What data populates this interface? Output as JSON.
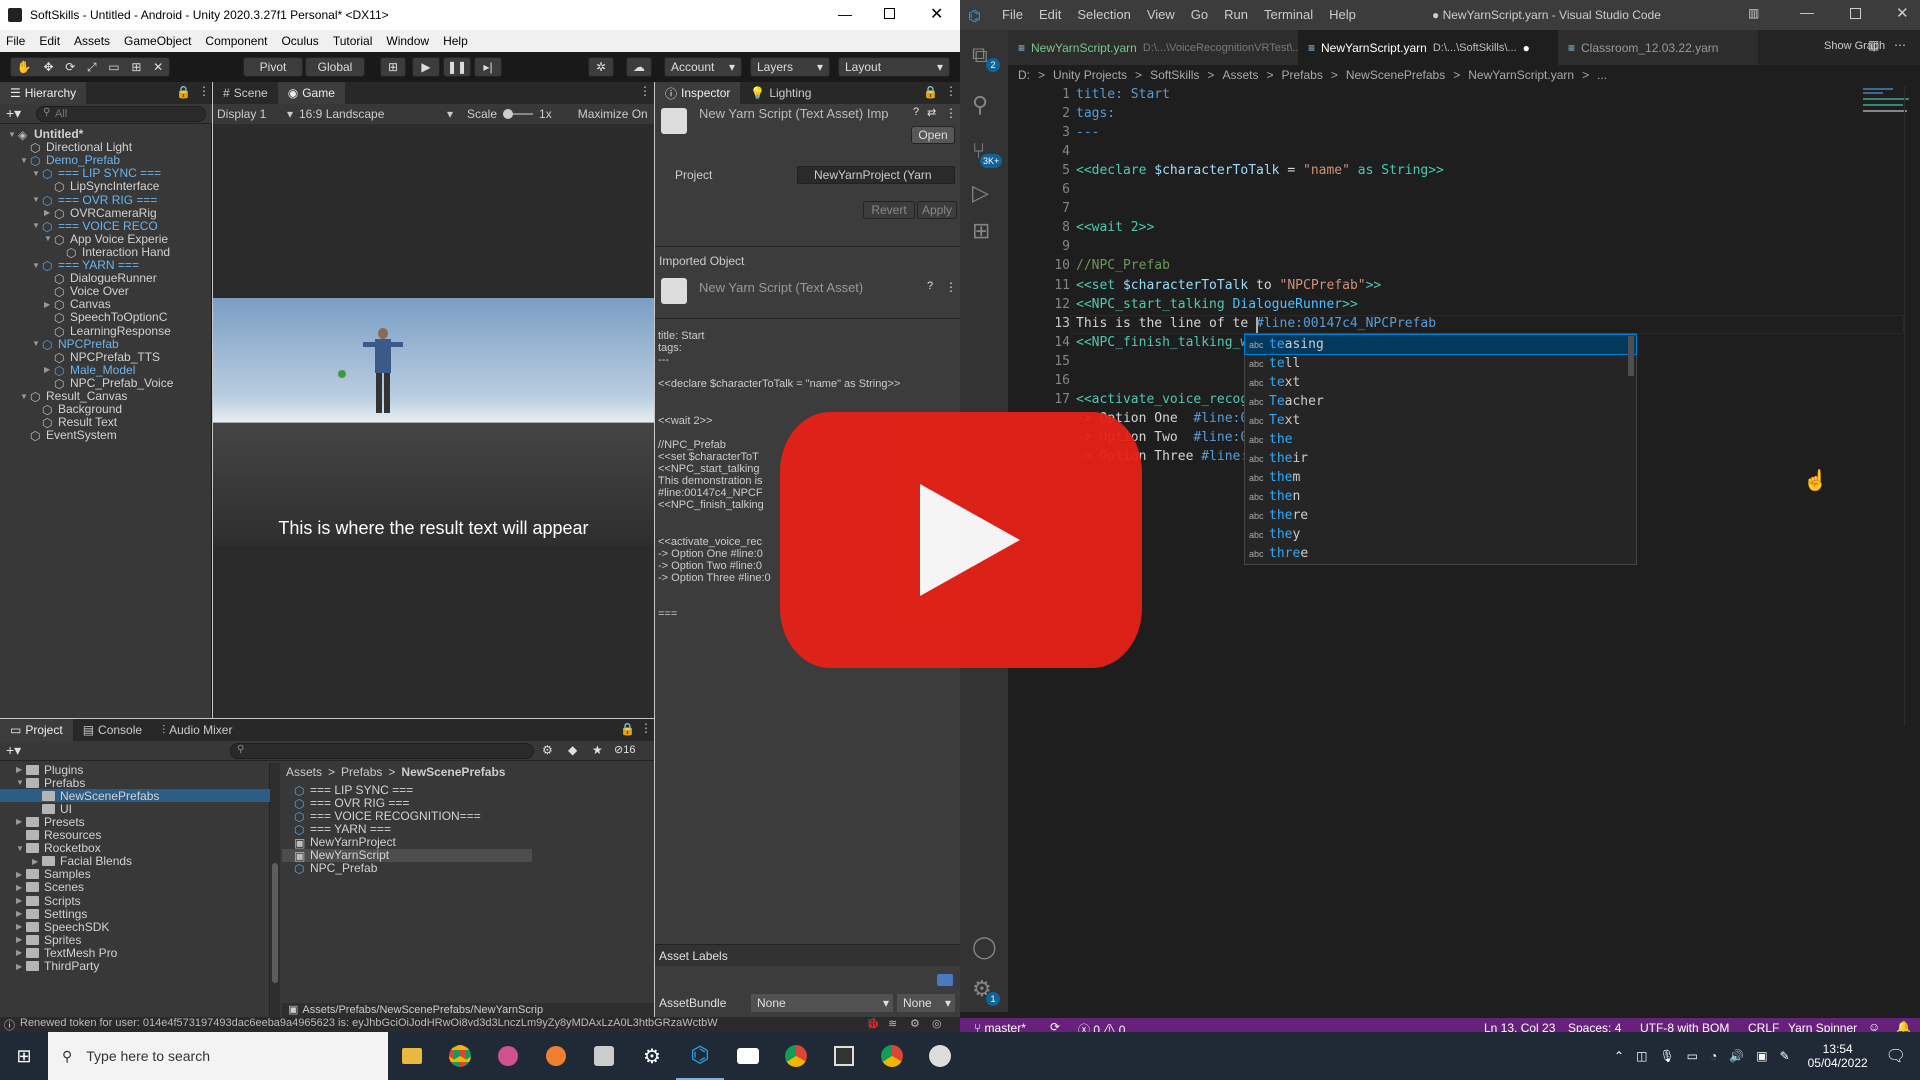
{
  "unity": {
    "title": "SoftSkills - Untitled - Android - Unity 2020.3.27f1 Personal* <DX11>",
    "menu": [
      "File",
      "Edit",
      "Assets",
      "GameObject",
      "Component",
      "Oculus",
      "Tutorial",
      "Window",
      "Help"
    ],
    "toolbar": {
      "pivot": "Pivot",
      "global": "Global",
      "account": "Account",
      "layers": "Layers",
      "layout": "Layout"
    },
    "hierarchy": {
      "tab": "Hierarchy",
      "search_placeholder": "All",
      "items": [
        {
          "label": "Untitled*",
          "depth": 0,
          "type": "scene",
          "fold": "open"
        },
        {
          "label": "Directional Light",
          "depth": 1,
          "type": "grey",
          "fold": ""
        },
        {
          "label": "Demo_Prefab",
          "depth": 1,
          "type": "blue",
          "fold": "open"
        },
        {
          "label": "=== LIP SYNC ===",
          "depth": 2,
          "type": "blue",
          "fold": "open"
        },
        {
          "label": "LipSyncInterface",
          "depth": 3,
          "type": "grey",
          "fold": ""
        },
        {
          "label": "=== OVR RIG ===",
          "depth": 2,
          "type": "blue",
          "fold": "open"
        },
        {
          "label": "OVRCameraRig",
          "depth": 3,
          "type": "grey",
          "fold": "closed"
        },
        {
          "label": "=== VOICE RECO",
          "depth": 2,
          "type": "blue",
          "fold": "open"
        },
        {
          "label": "App Voice Experie",
          "depth": 3,
          "type": "grey",
          "fold": "open"
        },
        {
          "label": "Interaction Hand",
          "depth": 4,
          "type": "grey",
          "fold": ""
        },
        {
          "label": "=== YARN ===",
          "depth": 2,
          "type": "blue",
          "fold": "open"
        },
        {
          "label": "DialogueRunner",
          "depth": 3,
          "type": "grey",
          "fold": ""
        },
        {
          "label": "Voice Over",
          "depth": 3,
          "type": "grey",
          "fold": ""
        },
        {
          "label": "Canvas",
          "depth": 3,
          "type": "grey",
          "fold": "closed"
        },
        {
          "label": "SpeechToOptionC",
          "depth": 3,
          "type": "grey",
          "fold": ""
        },
        {
          "label": "LearningResponse",
          "depth": 3,
          "type": "grey",
          "fold": ""
        },
        {
          "label": "NPCPrefab",
          "depth": 2,
          "type": "blue",
          "fold": "open"
        },
        {
          "label": "NPCPrefab_TTS",
          "depth": 3,
          "type": "grey",
          "fold": ""
        },
        {
          "label": "Male_Model",
          "depth": 3,
          "type": "blue",
          "fold": "closed"
        },
        {
          "label": "NPC_Prefab_Voice",
          "depth": 3,
          "type": "grey",
          "fold": ""
        },
        {
          "label": "Result_Canvas",
          "depth": 1,
          "type": "grey",
          "fold": "open"
        },
        {
          "label": "Background",
          "depth": 2,
          "type": "grey",
          "fold": ""
        },
        {
          "label": "Result Text",
          "depth": 2,
          "type": "grey",
          "fold": ""
        },
        {
          "label": "EventSystem",
          "depth": 1,
          "type": "grey",
          "fold": ""
        }
      ]
    },
    "game": {
      "tab_scene": "Scene",
      "tab_game": "Game",
      "display": "Display 1",
      "aspect": "16:9 Landscape",
      "scale_label": "Scale",
      "scale_value": "1x",
      "maximize": "Maximize On",
      "result_text": "This is where the result text will appear"
    },
    "inspector": {
      "tab": "Inspector",
      "tab2": "Lighting",
      "asset_title": "New Yarn Script (Text Asset) Imp",
      "open_btn": "Open",
      "project_label": "Project",
      "project_value": "NewYarnProject (Yarn",
      "revert": "Revert",
      "apply": "Apply",
      "imported_header": "Imported Object",
      "imported_title": "New Yarn Script (Text Asset)",
      "preview_lines": [
        "title: Start",
        "tags:",
        "---",
        "",
        "<<declare $characterToTalk = \"name\" as String>>",
        "",
        "",
        "<<wait 2>>",
        "",
        "//NPC_Prefab",
        "<<set $characterToT",
        "<<NPC_start_talking",
        "This demonstration is",
        "#line:00147c4_NPCF",
        "<<NPC_finish_talking",
        "",
        "",
        "<<activate_voice_rec",
        "-> Option One  #line:0",
        "-> Option Two  #line:0",
        "-> Option Three #line:0",
        "",
        "",
        "==="
      ],
      "asset_labels": "Asset Labels",
      "assetbundle_label": "AssetBundle",
      "assetbundle_value": "None",
      "assetbundle_variant": "None"
    },
    "project": {
      "tab_project": "Project",
      "tab_console": "Console",
      "tab_audio": "Audio Mixer",
      "count": "16",
      "tree": [
        {
          "label": "Plugins",
          "depth": 1,
          "fold": "closed"
        },
        {
          "label": "Prefabs",
          "depth": 1,
          "fold": "open"
        },
        {
          "label": "NewScenePrefabs",
          "depth": 2,
          "fold": "",
          "selected": true
        },
        {
          "label": "UI",
          "depth": 2,
          "fold": ""
        },
        {
          "label": "Presets",
          "depth": 1,
          "fold": "closed"
        },
        {
          "label": "Resources",
          "depth": 1,
          "fold": ""
        },
        {
          "label": "Rocketbox",
          "depth": 1,
          "fold": "open"
        },
        {
          "label": "Facial Blends",
          "depth": 2,
          "fold": "closed"
        },
        {
          "label": "Samples",
          "depth": 1,
          "fold": "closed"
        },
        {
          "label": "Scenes",
          "depth": 1,
          "fold": "closed"
        },
        {
          "label": "Scripts",
          "depth": 1,
          "fold": "closed"
        },
        {
          "label": "Settings",
          "depth": 1,
          "fold": "closed"
        },
        {
          "label": "SpeechSDK",
          "depth": 1,
          "fold": "closed"
        },
        {
          "label": "Sprites",
          "depth": 1,
          "fold": "closed"
        },
        {
          "label": "TextMesh Pro",
          "depth": 1,
          "fold": "closed"
        },
        {
          "label": "ThirdParty",
          "depth": 1,
          "fold": "closed"
        }
      ],
      "breadcrumb": [
        "Assets",
        "Prefabs",
        "NewScenePrefabs"
      ],
      "files": [
        {
          "label": "=== LIP SYNC ===",
          "type": "prefab"
        },
        {
          "label": "=== OVR RIG ===",
          "type": "prefab"
        },
        {
          "label": "=== VOICE RECOGNITION===",
          "type": "prefab"
        },
        {
          "label": "=== YARN ===",
          "type": "prefab"
        },
        {
          "label": "NewYarnProject",
          "type": "yarn"
        },
        {
          "label": "NewYarnScript",
          "type": "yarn",
          "selected": true
        },
        {
          "label": "NPC_Prefab",
          "type": "prefab"
        }
      ],
      "path": "Assets/Prefabs/NewScenePrefabs/NewYarnScrip"
    },
    "status": "Renewed token for user: 014e4f573197493dac6eeba9a4965623 is: eyJhbGciOiJodHRwOi8vd3d3LnczLm9yZy8yMDAxLzA0L3htbGRzaWctbW"
  },
  "vscode": {
    "menu": [
      "File",
      "Edit",
      "Selection",
      "View",
      "Go",
      "Run",
      "Terminal",
      "Help"
    ],
    "title": "● NewYarnScript.yarn - Visual Studio Code",
    "tabs": [
      {
        "label": "NewYarnScript.yarn",
        "path": "D:\\...\\VoiceRecognitionVRTest\\...",
        "flag": "U"
      },
      {
        "label": "NewYarnScript.yarn",
        "path": "D:\\...\\SoftSkills\\...",
        "flag": "●"
      },
      {
        "label": "Classroom_12.03.22.yarn",
        "path": "",
        "flag": ""
      }
    ],
    "show_graph": "Show Graph",
    "breadcrumb": [
      "D:",
      "Unity Projects",
      "SoftSkills",
      "Assets",
      "Prefabs",
      "NewScenePrefabs",
      "NewYarnScript.yarn",
      "..."
    ],
    "badges": {
      "explorer": "2",
      "scm": "3K+",
      "settings": "1"
    },
    "code": [
      {
        "n": "1",
        "segs": [
          {
            "t": "title: Start",
            "c": "#569cd6"
          }
        ]
      },
      {
        "n": "2",
        "segs": [
          {
            "t": "tags:",
            "c": "#569cd6"
          }
        ]
      },
      {
        "n": "3",
        "segs": [
          {
            "t": "---",
            "c": "#569cd6"
          }
        ]
      },
      {
        "n": "4",
        "segs": []
      },
      {
        "n": "5",
        "segs": [
          {
            "t": "<<declare ",
            "c": "#4ec9b0"
          },
          {
            "t": "$characterToTalk",
            "c": "#9cdcfe"
          },
          {
            "t": " = ",
            "c": "#d4d4d4"
          },
          {
            "t": "\"name\"",
            "c": "#ce9178"
          },
          {
            "t": " as String>>",
            "c": "#4ec9b0"
          }
        ]
      },
      {
        "n": "6",
        "segs": []
      },
      {
        "n": "7",
        "segs": []
      },
      {
        "n": "8",
        "segs": [
          {
            "t": "<<wait 2>>",
            "c": "#4ec9b0"
          }
        ]
      },
      {
        "n": "9",
        "segs": []
      },
      {
        "n": "10",
        "segs": [
          {
            "t": "//NPC_Prefab",
            "c": "#6a9955"
          }
        ]
      },
      {
        "n": "11",
        "segs": [
          {
            "t": "<<set ",
            "c": "#4ec9b0"
          },
          {
            "t": "$characterToTalk",
            "c": "#9cdcfe"
          },
          {
            "t": " to ",
            "c": "#d4d4d4"
          },
          {
            "t": "\"NPCPrefab\"",
            "c": "#ce9178"
          },
          {
            "t": ">>",
            "c": "#4ec9b0"
          }
        ]
      },
      {
        "n": "12",
        "segs": [
          {
            "t": "<<NPC_start_talking ",
            "c": "#4ec9b0"
          },
          {
            "t": "DialogueRunner",
            "c": "#4fc1ff"
          },
          {
            "t": ">>",
            "c": "#4ec9b0"
          }
        ]
      },
      {
        "n": "13",
        "segs": [
          {
            "t": "This is the line of te",
            "c": "#d4d4d4"
          },
          {
            "t": " #line:00147c4_NPCPrefab",
            "c": "#569cd6"
          }
        ]
      },
      {
        "n": "14",
        "segs": [
          {
            "t": "<<NPC_finish_talking_w",
            "c": "#4ec9b0"
          }
        ]
      },
      {
        "n": "15",
        "segs": []
      },
      {
        "n": "16",
        "segs": []
      },
      {
        "n": "17",
        "segs": [
          {
            "t": "<<activate_voice_recog",
            "c": "#4ec9b0"
          }
        ]
      },
      {
        "n": "",
        "segs": [
          {
            "t": "-> Option One  ",
            "c": "#d4d4d4"
          },
          {
            "t": "#line:0",
            "c": "#569cd6"
          }
        ]
      },
      {
        "n": "",
        "segs": [
          {
            "t": "-> Option Two  ",
            "c": "#d4d4d4"
          },
          {
            "t": "#line:0",
            "c": "#569cd6"
          }
        ]
      },
      {
        "n": "",
        "segs": [
          {
            "t": "-> Option Three ",
            "c": "#d4d4d4"
          },
          {
            "t": "#line:",
            "c": "#569cd6"
          }
        ]
      }
    ],
    "suggest": [
      {
        "m": "te",
        "r": "asing"
      },
      {
        "m": "te",
        "r": "ll",
        "pre": ""
      },
      {
        "m": "te",
        "r": "xt"
      },
      {
        "m": "Te",
        "r": "acher"
      },
      {
        "m": "Te",
        "r": "xt"
      },
      {
        "m": "the",
        "r": ""
      },
      {
        "m": "the",
        "r": "ir"
      },
      {
        "m": "the",
        "r": "m"
      },
      {
        "m": "the",
        "r": "n"
      },
      {
        "m": "the",
        "r": "re"
      },
      {
        "m": "the",
        "r": "y"
      },
      {
        "m": "thre",
        "r": "e"
      }
    ],
    "suggest_words": [
      "teasing",
      "tell",
      "text",
      "Teacher",
      "Text",
      "the",
      "their",
      "them",
      "then",
      "there",
      "they",
      "three"
    ],
    "status": {
      "branch": "master*",
      "errors": "0",
      "warnings": "0",
      "position": "Ln 13, Col 23",
      "spaces": "Spaces: 4",
      "encoding": "UTF-8 with BOM",
      "eol": "CRLF",
      "language": "Yarn Spinner"
    }
  },
  "taskbar": {
    "search_placeholder": "Type here to search",
    "time": "13:54",
    "date": "05/04/2022"
  }
}
